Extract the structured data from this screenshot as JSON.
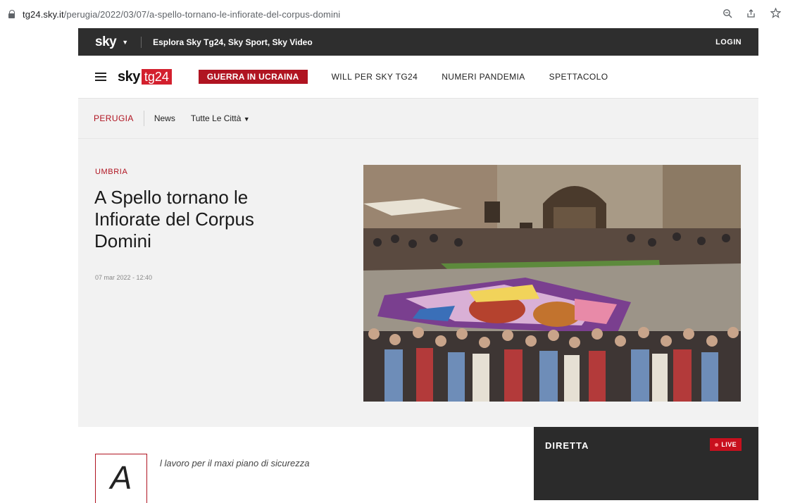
{
  "browser": {
    "url_domain": "tg24.sky.it",
    "url_path": "/perugia/2022/03/07/a-spello-tornano-le-infiorate-del-corpus-domini"
  },
  "topbar": {
    "brand": "sky",
    "explore": "Esplora Sky Tg24, Sky Sport, Sky Video",
    "login": "LOGIN"
  },
  "navbar": {
    "logo_sky": "sky",
    "logo_tg": "tg24",
    "links": [
      {
        "label": "GUERRA IN UCRAINA",
        "highlight": true
      },
      {
        "label": "WILL PER SKY TG24",
        "highlight": false
      },
      {
        "label": "NUMERI PANDEMIA",
        "highlight": false
      },
      {
        "label": "SPETTACOLO",
        "highlight": false
      }
    ]
  },
  "subnav": {
    "city": "PERUGIA",
    "news": "News",
    "cities": "Tutte Le Città"
  },
  "article": {
    "kicker": "UMBRIA",
    "headline": "A Spello tornano le Infiorate del Corpus Domini",
    "date": "07 mar 2022 - 12:40",
    "dropcap": "A",
    "intro": "l lavoro per il maxi piano di sicurezza"
  },
  "live": {
    "title": "DIRETTA",
    "badge": "LIVE"
  },
  "colors": {
    "accent": "#b01421",
    "topbar": "#2e2e2e",
    "live_box": "#2b2b2b"
  },
  "icons": [
    "lock-icon",
    "zoom-icon",
    "share-icon",
    "star-icon",
    "hamburger-icon",
    "caret-down-icon"
  ]
}
